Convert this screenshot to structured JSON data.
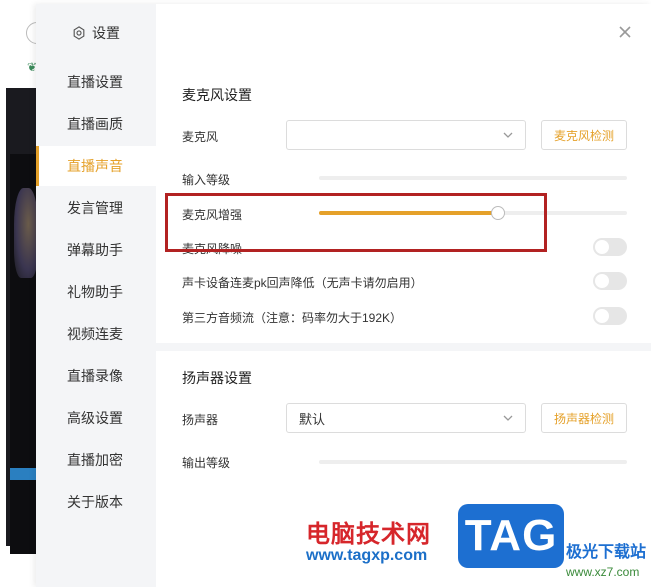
{
  "dialog": {
    "title": "设置",
    "close_icon": "close-icon"
  },
  "sidebar": {
    "items": [
      {
        "label": "直播设置",
        "active": false
      },
      {
        "label": "直播画质",
        "active": false
      },
      {
        "label": "直播声音",
        "active": true
      },
      {
        "label": "发言管理",
        "active": false
      },
      {
        "label": "弹幕助手",
        "active": false
      },
      {
        "label": "礼物助手",
        "active": false
      },
      {
        "label": "视频连麦",
        "active": false
      },
      {
        "label": "直播录像",
        "active": false
      },
      {
        "label": "高级设置",
        "active": false
      },
      {
        "label": "直播加密",
        "active": false
      },
      {
        "label": "关于版本",
        "active": false
      }
    ]
  },
  "mic": {
    "section_title": "麦克风设置",
    "device_label": "麦克风",
    "device_value": "",
    "detect_button": "麦克风检测",
    "input_level_label": "输入等级",
    "boost_label": "麦克风增强",
    "boost_value_percent": 58,
    "denoise_label": "麦克风降噪",
    "denoise_on": false,
    "echo_label": "声卡设备连麦pk回声降低（无声卡请勿启用）",
    "echo_on": false,
    "third_party_label": "第三方音频流（注意：码率勿大于192K）",
    "third_party_on": false
  },
  "speaker": {
    "section_title": "扬声器设置",
    "device_label": "扬声器",
    "device_value": "默认",
    "detect_button": "扬声器检测",
    "output_level_label": "输出等级"
  },
  "watermark": {
    "site_name": "电脑技术网",
    "url": "www.tagxp.com",
    "tag": "TAG",
    "side_text": "极光下载站",
    "side_url": "www.xz7.com"
  },
  "colors": {
    "accent": "#e5a12a",
    "highlight_border": "#b22222"
  }
}
